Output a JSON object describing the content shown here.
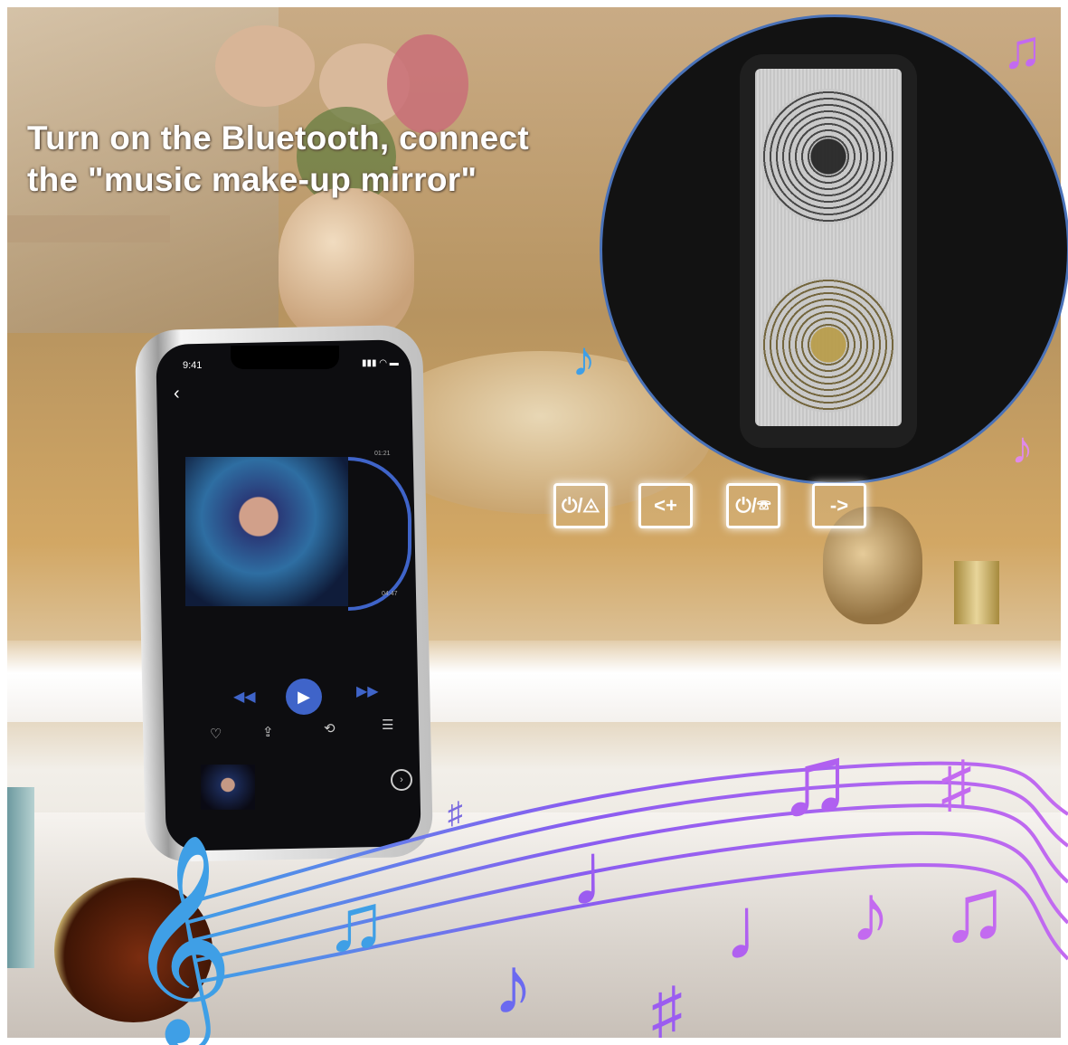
{
  "headline": {
    "line1": "Turn on the Bluetooth, connect",
    "line2": "the \"music make-up mirror\""
  },
  "phone": {
    "status_time": "9:41",
    "status_icons": "▮▮▮ ◠ ▬",
    "track_time_start": "01:21",
    "track_time_end": "04:47"
  },
  "touch_buttons": [
    {
      "label": "⏻/◬",
      "icon": "power-light-toggle-icon"
    },
    {
      "label": "<+",
      "icon": "volume-up-icon"
    },
    {
      "label": "⏻/☏",
      "icon": "phone-call-icon"
    },
    {
      "label": "->",
      "icon": "next-track-icon"
    }
  ],
  "colors": {
    "accent_blue": "#3f64c9",
    "note_blue": "#3f9fe6",
    "note_violet": "#9b5cf0",
    "note_purple": "#c36af0"
  }
}
